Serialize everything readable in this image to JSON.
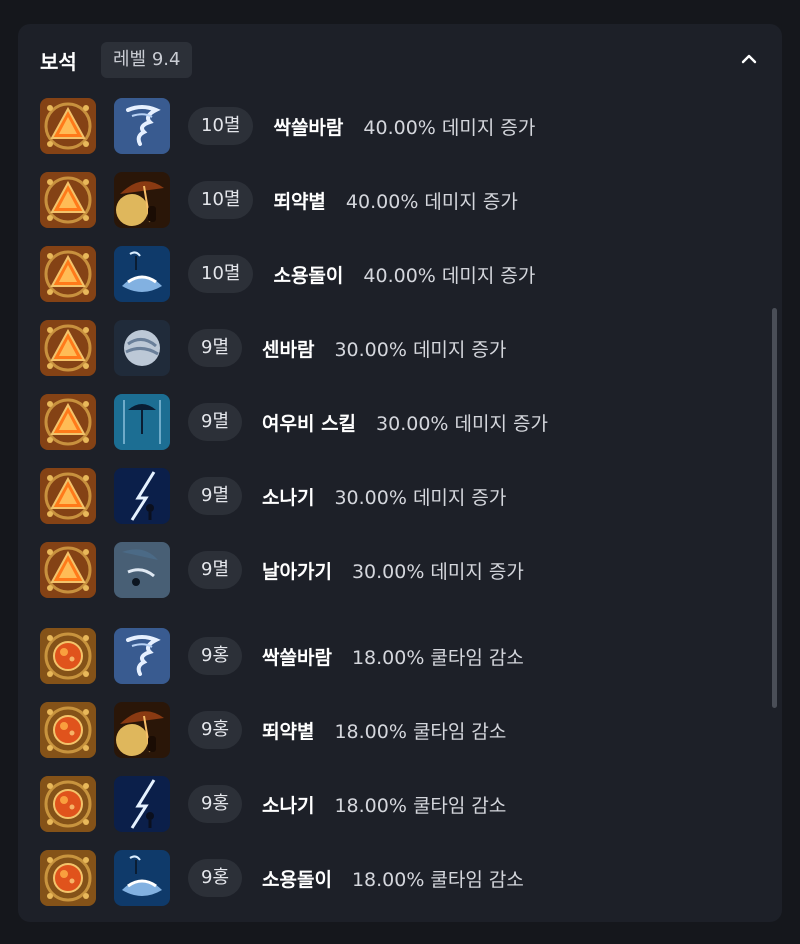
{
  "section": {
    "title": "보석",
    "level_badge": "레벨 9.4",
    "collapse_icon": "chevron-up-icon"
  },
  "colors": {
    "panel_bg": "#1d2028",
    "page_bg": "#15171c",
    "pill_bg": "#2c3038",
    "damage_gem": "#ff7a1a",
    "cooldown_gem": "#e0531c"
  },
  "rows": [
    {
      "grade": "10멸",
      "skill": "싹쓸바람",
      "effect": "40.00% 데미지 증가",
      "gem_type": "damage-gem-icon",
      "skill_icon": "tornado-skill-icon"
    },
    {
      "grade": "10멸",
      "skill": "뙤약볕",
      "effect": "40.00% 데미지 증가",
      "gem_type": "damage-gem-icon",
      "skill_icon": "sun-parasol-skill-icon"
    },
    {
      "grade": "10멸",
      "skill": "소용돌이",
      "effect": "40.00% 데미지 증가",
      "gem_type": "damage-gem-icon",
      "skill_icon": "whirlpool-skill-icon"
    },
    {
      "grade": "9멸",
      "skill": "센바람",
      "effect": "30.00% 데미지 증가",
      "gem_type": "damage-gem-icon",
      "skill_icon": "wind-skill-icon"
    },
    {
      "grade": "9멸",
      "skill": "여우비 스킬",
      "effect": "30.00% 데미지 증가",
      "gem_type": "damage-gem-icon",
      "skill_icon": "rain-umbrella-skill-icon"
    },
    {
      "grade": "9멸",
      "skill": "소나기",
      "effect": "30.00% 데미지 증가",
      "gem_type": "damage-gem-icon",
      "skill_icon": "shower-skill-icon"
    },
    {
      "grade": "9멸",
      "skill": "날아가기",
      "effect": "30.00% 데미지 증가",
      "gem_type": "damage-gem-icon",
      "skill_icon": "fly-skill-icon"
    },
    {
      "grade": "9홍",
      "skill": "싹쓸바람",
      "effect": "18.00% 쿨타임 감소",
      "gem_type": "cooldown-gem-icon",
      "skill_icon": "tornado-skill-icon"
    },
    {
      "grade": "9홍",
      "skill": "뙤약볕",
      "effect": "18.00% 쿨타임 감소",
      "gem_type": "cooldown-gem-icon",
      "skill_icon": "sun-parasol-skill-icon"
    },
    {
      "grade": "9홍",
      "skill": "소나기",
      "effect": "18.00% 쿨타임 감소",
      "gem_type": "cooldown-gem-icon",
      "skill_icon": "shower-skill-icon"
    },
    {
      "grade": "9홍",
      "skill": "소용돌이",
      "effect": "18.00% 쿨타임 감소",
      "gem_type": "cooldown-gem-icon",
      "skill_icon": "whirlpool-skill-icon"
    }
  ]
}
